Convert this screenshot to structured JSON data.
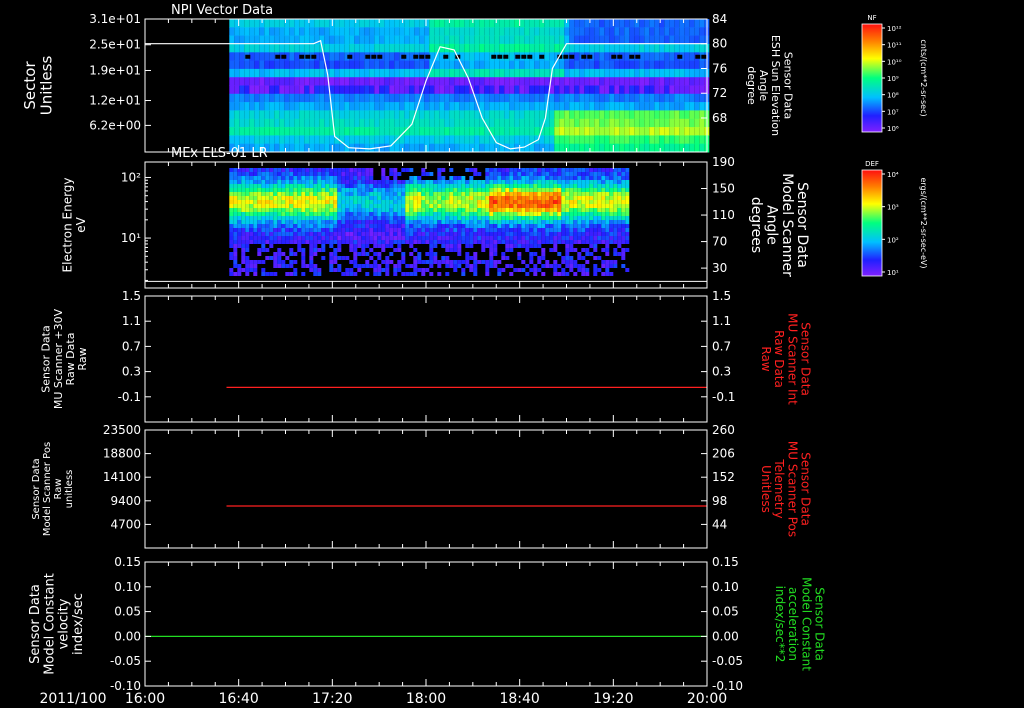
{
  "colors": {
    "background": "#000000",
    "axes": "#ffffff",
    "red_trace": "#ff2020",
    "green_trace": "#22dd22",
    "white_trace": "#ffffff"
  },
  "time_axis": {
    "prefix": "2011/100",
    "ticks": [
      "16:00",
      "16:40",
      "17:20",
      "18:00",
      "18:40",
      "19:20",
      "20:00"
    ],
    "tick_hours": [
      16.0,
      16.6667,
      17.3333,
      18.0,
      18.6667,
      19.3333,
      20.0
    ],
    "range_hours": [
      16.0,
      20.0
    ]
  },
  "chart_data": [
    {
      "type": "heatmap",
      "title": "NPI Vector Data",
      "ylabel": [
        "Sector",
        "Unitless"
      ],
      "yticks": [
        "3.1e+01",
        "2.5e+01",
        "1.9e+01",
        "1.2e+01",
        "6.2e+00"
      ],
      "ylim": [
        0,
        31
      ],
      "data_start_hour": 16.6,
      "data_end_hour": 20.0,
      "overlay": {
        "type": "line",
        "name": "ESH Sun Elevation Angle",
        "ylabel_right": [
          "Sensor Data",
          "ESH Sun Elevation",
          "Angle",
          "degree"
        ],
        "yticks_right": [
          "84",
          "80",
          "76",
          "72",
          "68"
        ],
        "ylim_right": [
          62.5,
          84
        ],
        "x_hours": [
          16.0,
          17.1,
          17.2,
          17.25,
          17.3,
          17.35,
          17.45,
          17.6,
          17.75,
          17.9,
          18.0,
          18.1,
          18.2,
          18.3,
          18.4,
          18.5,
          18.6,
          18.7,
          18.8,
          18.85,
          18.9,
          19.0,
          19.1,
          20.0
        ],
        "y": [
          80,
          80,
          80,
          80.5,
          75,
          65,
          63.2,
          63,
          63.5,
          67,
          74,
          79.5,
          79,
          74.5,
          68,
          64,
          63,
          63.3,
          64.5,
          68,
          76,
          80,
          80,
          80
        ]
      },
      "colorbar": {
        "label": "NF",
        "units": "cnts/(cm**2-sr-sec)",
        "ticks": [
          "10¹²",
          "10¹¹",
          "10¹⁰",
          "10⁹",
          "10⁸",
          "10⁷",
          "10⁶"
        ]
      }
    },
    {
      "type": "heatmap",
      "title": "MEx ELS-01 LR",
      "ylabel": [
        "Electron Energy",
        "eV"
      ],
      "yticks": [
        "10²",
        "10¹"
      ],
      "ytick_values": [
        100,
        10
      ],
      "ylim": [
        1.5,
        180
      ],
      "yscale": "log",
      "data_start_hour": 16.6,
      "data_end_hour": 19.44,
      "overlay": {
        "type": "line",
        "name": "Model Scanner Angle",
        "ylabel_right": [
          "Sensor Data",
          "Model Scanner",
          "Angle",
          "degrees"
        ],
        "yticks_right": [
          "190",
          "150",
          "110",
          "70",
          "30"
        ],
        "ylim_right": [
          0,
          190
        ],
        "x_hours": [
          16.0,
          20.0
        ],
        "y": [
          10,
          10
        ]
      },
      "colorbar": {
        "label": "DEF",
        "units": "ergs/(cm**2-sr-sec-eV)",
        "ticks": [
          "10⁴",
          "10³",
          "10²",
          "10¹"
        ]
      }
    },
    {
      "type": "line",
      "ylabel": [
        "Sensor Data",
        "MU Scanner +30V",
        "Raw Data",
        "Raw"
      ],
      "yticks": [
        "1.5",
        "1.1",
        "0.7",
        "0.3",
        "-0.1"
      ],
      "ylim": [
        -0.5,
        1.5
      ],
      "series": [
        {
          "name": "MU Scanner Int Raw Data",
          "x_hours": [
            16.58,
            20.0
          ],
          "y": [
            0.05,
            0.05
          ]
        }
      ],
      "ylabel_right": [
        "Sensor Data",
        "MU Scanner Int",
        "Raw Data",
        "Raw"
      ],
      "yticks_right": [
        "1.5",
        "1.1",
        "0.7",
        "0.3",
        "-0.1"
      ],
      "ylim_right": [
        -0.5,
        1.5
      ]
    },
    {
      "type": "line",
      "ylabel": [
        "Sensor Data",
        "Model Scanner Pos",
        "Raw",
        "unitless"
      ],
      "yticks": [
        "23500",
        "18800",
        "14100",
        "9400",
        "4700"
      ],
      "ylim": [
        0,
        23500
      ],
      "series": [
        {
          "name": "MU Scanner Pos Telemetry",
          "x_hours": [
            16.58,
            20.0
          ],
          "y": [
            86,
            86
          ]
        }
      ],
      "ylabel_right": [
        "Sensor Data",
        "MU Scanner Pos",
        "Telemetry",
        "Unitless"
      ],
      "yticks_right": [
        "260",
        "206",
        "152",
        "98",
        "44"
      ],
      "ylim_right": [
        -10,
        260
      ]
    },
    {
      "type": "line",
      "ylabel": [
        "Sensor Data",
        "Model Constant",
        "velocity",
        "index/sec"
      ],
      "yticks": [
        "0.15",
        "0.10",
        "0.05",
        "0.00",
        "-0.05",
        "-0.10"
      ],
      "ylim": [
        -0.1,
        0.15
      ],
      "series": [
        {
          "name": "Model Constant acceleration",
          "x_hours": [
            16.0,
            20.0
          ],
          "y": [
            0.0,
            0.0
          ]
        }
      ],
      "ylabel_right": [
        "Sensor Data",
        "Model Constant",
        "acceleration",
        "index/sec**2"
      ],
      "yticks_right": [
        "0.15",
        "0.10",
        "0.05",
        "0.00",
        "-0.05",
        "-0.10"
      ],
      "ylim_right": [
        -0.1,
        0.15
      ]
    }
  ]
}
